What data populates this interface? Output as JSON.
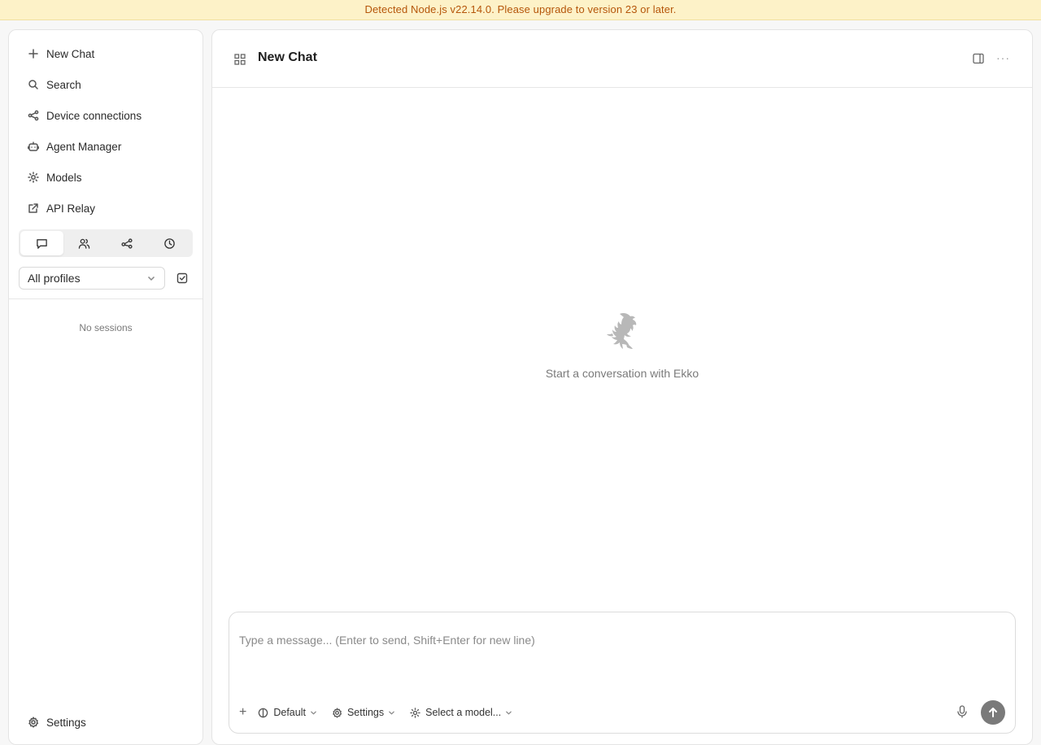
{
  "banner": {
    "text": "Detected Node.js v22.14.0. Please upgrade to version 23 or later."
  },
  "sidebar": {
    "items": [
      {
        "label": "New Chat",
        "icon": "plus-icon"
      },
      {
        "label": "Search",
        "icon": "search-icon"
      },
      {
        "label": "Device connections",
        "icon": "share-icon"
      },
      {
        "label": "Agent Manager",
        "icon": "bot-icon"
      },
      {
        "label": "Models",
        "icon": "sun-icon"
      },
      {
        "label": "API Relay",
        "icon": "external-link-icon"
      }
    ],
    "tabs": [
      {
        "icon": "chat-bubble-icon",
        "active": true
      },
      {
        "icon": "users-icon",
        "active": false
      },
      {
        "icon": "graph-icon",
        "active": false
      },
      {
        "icon": "clock-icon",
        "active": false
      }
    ],
    "profile_select": {
      "value": "All profiles"
    },
    "empty_text": "No sessions",
    "settings_label": "Settings"
  },
  "main": {
    "title": "New Chat",
    "empty_state": {
      "text": "Start a conversation with Ekko"
    },
    "composer": {
      "placeholder": "Type a message... (Enter to send, Shift+Enter for new line)",
      "mode_label": "Default",
      "settings_label": "Settings",
      "model_label": "Select a model..."
    }
  },
  "colors": {
    "banner_bg": "#fdf2c8",
    "banner_text": "#b5560a",
    "send_button": "#7a7a7a"
  }
}
